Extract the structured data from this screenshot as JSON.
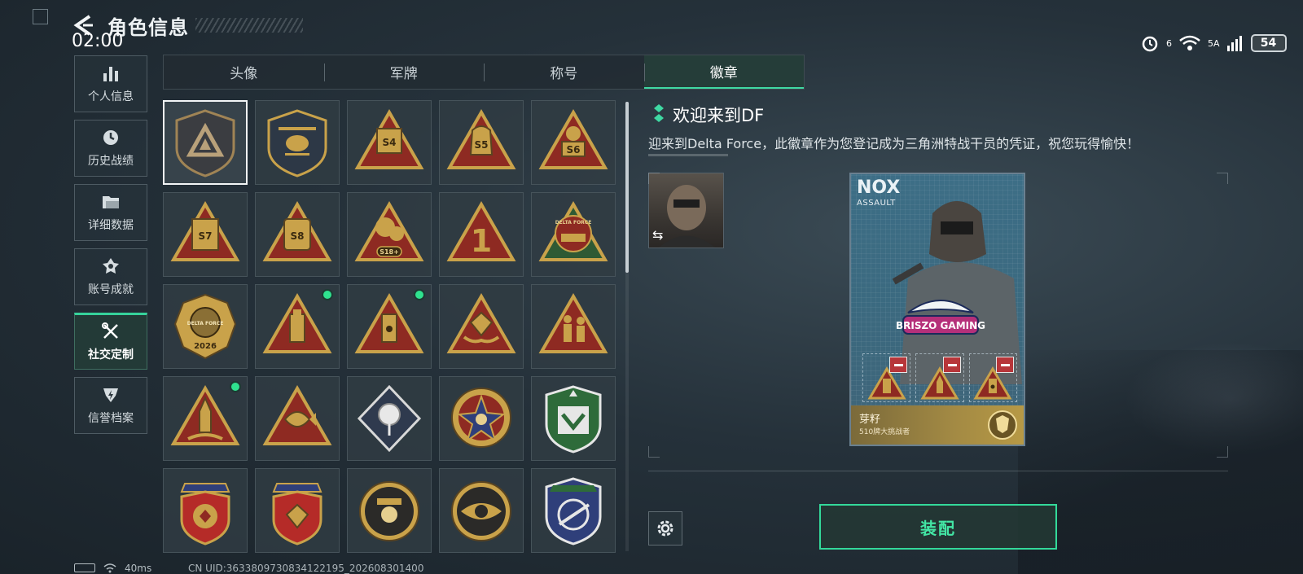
{
  "header": {
    "title": "角色信息",
    "clock": "02:00"
  },
  "status": {
    "net1": "6",
    "net2": "5A",
    "battery": "54"
  },
  "sidebar": {
    "items": [
      {
        "label": "个人信息",
        "icon": "bar-chart-icon"
      },
      {
        "label": "历史战绩",
        "icon": "history-icon"
      },
      {
        "label": "详细数据",
        "icon": "folder-icon"
      },
      {
        "label": "账号成就",
        "icon": "achievement-icon"
      },
      {
        "label": "社交定制",
        "icon": "tools-icon",
        "active": true
      },
      {
        "label": "信誉档案",
        "icon": "reputation-icon"
      }
    ]
  },
  "tabs": [
    "头像",
    "军牌",
    "称号",
    "徽章"
  ],
  "active_tab": "徽章",
  "badges": {
    "row1": {
      "b3": "S4",
      "b4": "S5",
      "b5": "S6"
    },
    "row2": {
      "b1": "S7",
      "b2": "S8",
      "b3": "S18+",
      "b4": "1",
      "b5": "DELTA FORCE"
    },
    "row3": {
      "b1_top": "DELTA FORCE",
      "b1_year": "2026"
    }
  },
  "detail": {
    "title": "欢迎来到DF",
    "description": "迎来到Delta Force，此徽章作为您登记成为三角洲特战干员的凭证，祝您玩得愉快！"
  },
  "card": {
    "operator": "NOX",
    "role": "ASSAULT",
    "team_logo": "BRISZO GAMING",
    "player_name": "芽籽",
    "player_sub": "510牌大挑战者"
  },
  "actions": {
    "equip": "装配"
  },
  "footer": {
    "ping": "40ms",
    "uid": "CN UID:3633809730834122195_202608301400"
  },
  "colors": {
    "accent": "#3fd9a3",
    "badge_gold": "#c9a24a",
    "badge_red": "#8e2a22"
  }
}
